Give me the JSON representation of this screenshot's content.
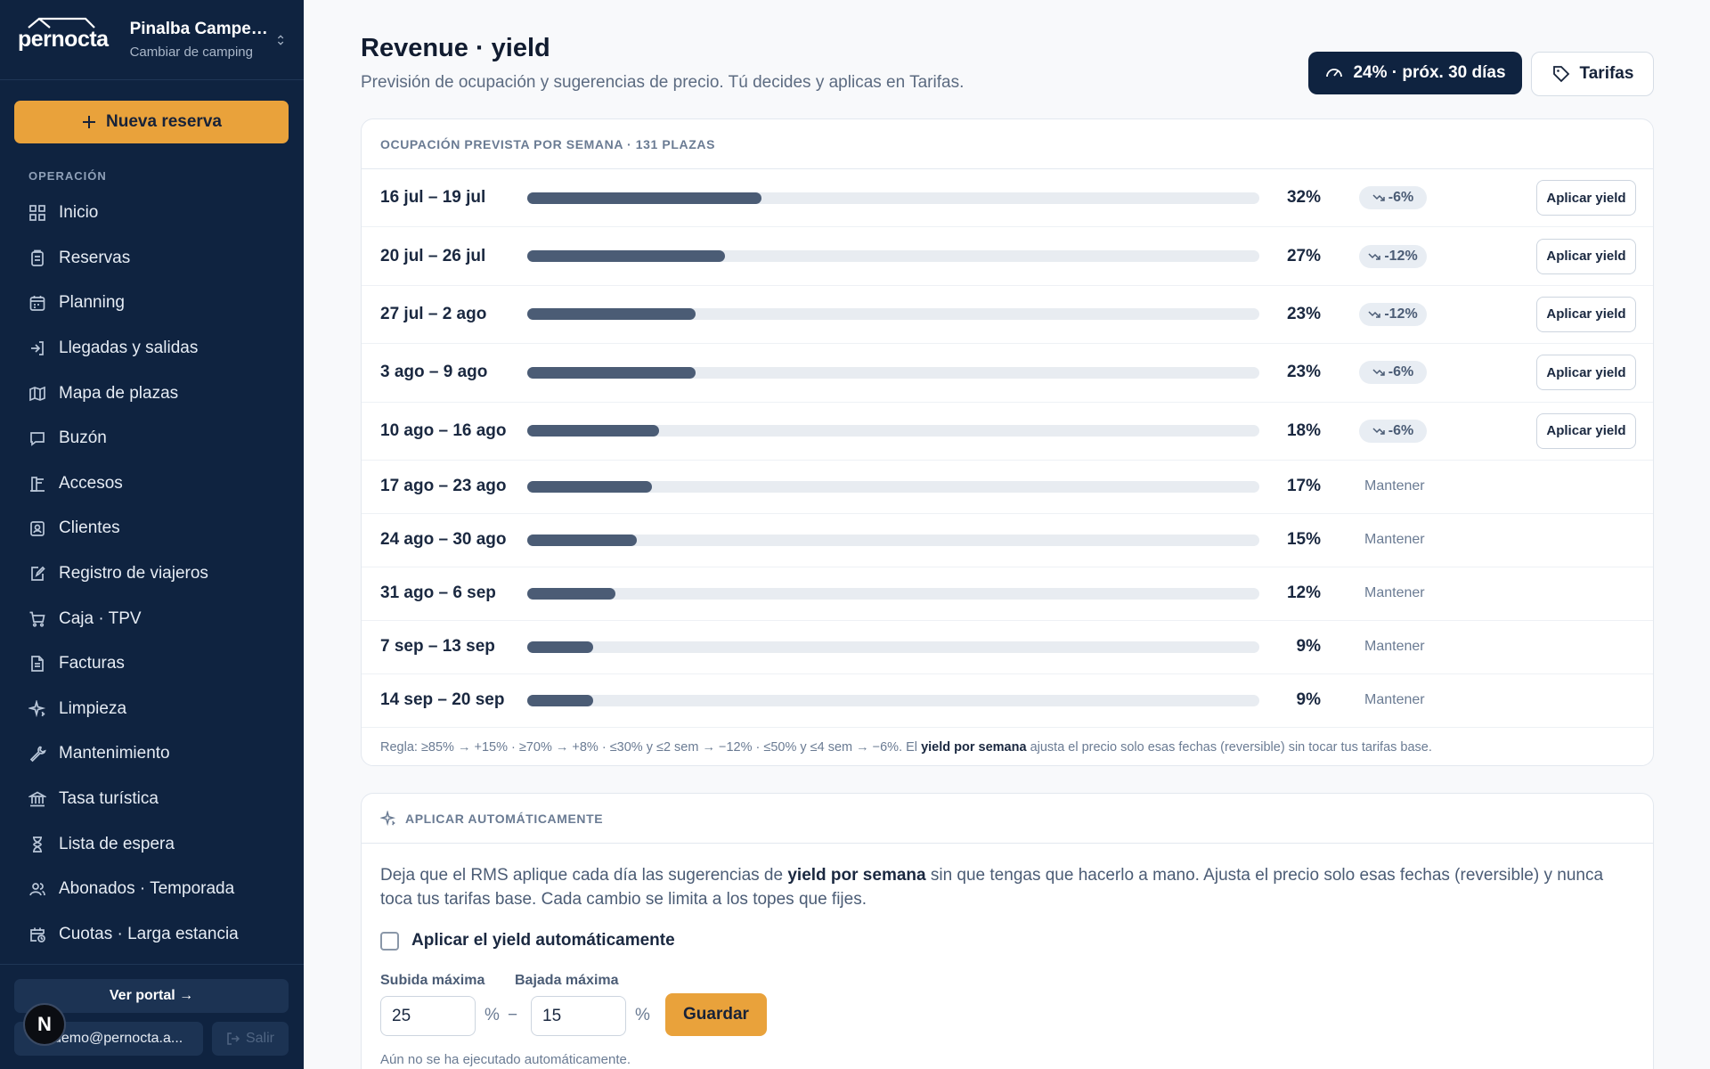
{
  "brand": {
    "logo": "pernocta",
    "camp_name": "Pinalba Campe…",
    "camp_sub": "Cambiar de camping"
  },
  "sidebar": {
    "new_booking": "Nueva reserva",
    "section_label": "OPERACIÓN",
    "items": [
      {
        "label": "Inicio",
        "icon": "grid-icon"
      },
      {
        "label": "Reservas",
        "icon": "clipboard-icon"
      },
      {
        "label": "Planning",
        "icon": "calendar-icon"
      },
      {
        "label": "Llegadas y salidas",
        "icon": "login-icon"
      },
      {
        "label": "Mapa de plazas",
        "icon": "map-icon"
      },
      {
        "label": "Buzón",
        "icon": "message-icon"
      },
      {
        "label": "Accesos",
        "icon": "barrier-icon"
      },
      {
        "label": "Clientes",
        "icon": "contact-icon"
      },
      {
        "label": "Registro de viajeros",
        "icon": "edit-icon"
      },
      {
        "label": "Caja · TPV",
        "icon": "cart-icon"
      },
      {
        "label": "Facturas",
        "icon": "file-icon"
      },
      {
        "label": "Limpieza",
        "icon": "sparkle-icon"
      },
      {
        "label": "Mantenimiento",
        "icon": "wrench-icon"
      },
      {
        "label": "Tasa turística",
        "icon": "bank-icon"
      },
      {
        "label": "Lista de espera",
        "icon": "hourglass-icon"
      },
      {
        "label": "Abonados · Temporada",
        "icon": "users-icon"
      },
      {
        "label": "Cuotas · Larga estancia",
        "icon": "calendar-clock-icon"
      }
    ],
    "portal_button": "Ver portal →",
    "email": "demo@pernocta.a...",
    "logout": "Salir",
    "avatar_letter": "N"
  },
  "header": {
    "title": "Revenue · yield",
    "subtitle": "Previsión de ocupación y sugerencias de precio. Tú decides y aplicas en Tarifas.",
    "occupancy_badge": "24% · próx. 30 días",
    "tarifas_button": "Tarifas"
  },
  "forecast": {
    "heading": "OCUPACIÓN PREVISTA POR SEMANA · 131 PLAZAS",
    "apply_label": "Aplicar yield",
    "keep_label": "Mantener",
    "weeks": [
      {
        "label": "16 jul – 19 jul",
        "pct": 32,
        "pct_text": "32%",
        "delta": "-6%",
        "action": "apply"
      },
      {
        "label": "20 jul – 26 jul",
        "pct": 27,
        "pct_text": "27%",
        "delta": "-12%",
        "action": "apply"
      },
      {
        "label": "27 jul – 2 ago",
        "pct": 23,
        "pct_text": "23%",
        "delta": "-12%",
        "action": "apply"
      },
      {
        "label": "3 ago – 9 ago",
        "pct": 23,
        "pct_text": "23%",
        "delta": "-6%",
        "action": "apply"
      },
      {
        "label": "10 ago – 16 ago",
        "pct": 18,
        "pct_text": "18%",
        "delta": "-6%",
        "action": "apply"
      },
      {
        "label": "17 ago – 23 ago",
        "pct": 17,
        "pct_text": "17%",
        "delta": "",
        "action": "keep"
      },
      {
        "label": "24 ago – 30 ago",
        "pct": 15,
        "pct_text": "15%",
        "delta": "",
        "action": "keep"
      },
      {
        "label": "31 ago – 6 sep",
        "pct": 12,
        "pct_text": "12%",
        "delta": "",
        "action": "keep"
      },
      {
        "label": "7 sep – 13 sep",
        "pct": 9,
        "pct_text": "9%",
        "delta": "",
        "action": "keep"
      },
      {
        "label": "14 sep – 20 sep",
        "pct": 9,
        "pct_text": "9%",
        "delta": "",
        "action": "keep"
      }
    ],
    "rule_prefix": "Regla: ≥85% → +15% · ≥70% → +8% · ≤30% y ≤2 sem → −12% · ≤50% y ≤4 sem → −6%. El ",
    "rule_bold": "yield por semana",
    "rule_suffix": " ajusta el precio solo esas fechas (reversible) sin tocar tus tarifas base."
  },
  "auto": {
    "heading": "APLICAR AUTOMÁTICAMENTE",
    "text_prefix": "Deja que el RMS aplique cada día las sugerencias de ",
    "text_bold": "yield por semana",
    "text_suffix": " sin que tengas que hacerlo a mano. Ajusta el precio solo esas fechas (reversible) y nunca toca tus tarifas base. Cada cambio se limita a los topes que fijes.",
    "checkbox_label": "Aplicar el yield automáticamente",
    "checkbox_checked": false,
    "max_up_label": "Subida máxima",
    "max_up_value": "25",
    "max_down_label": "Bajada máxima",
    "max_down_value": "15",
    "percent_sign": "%",
    "minus_sign": "−",
    "save_button": "Guardar",
    "status": "Aún no se ha ejecutado automáticamente."
  },
  "colors": {
    "sidebar_bg": "#0f2340",
    "accent": "#e9a23b",
    "bar_fill": "#4b5c75",
    "bar_track": "#e8ecf1"
  }
}
